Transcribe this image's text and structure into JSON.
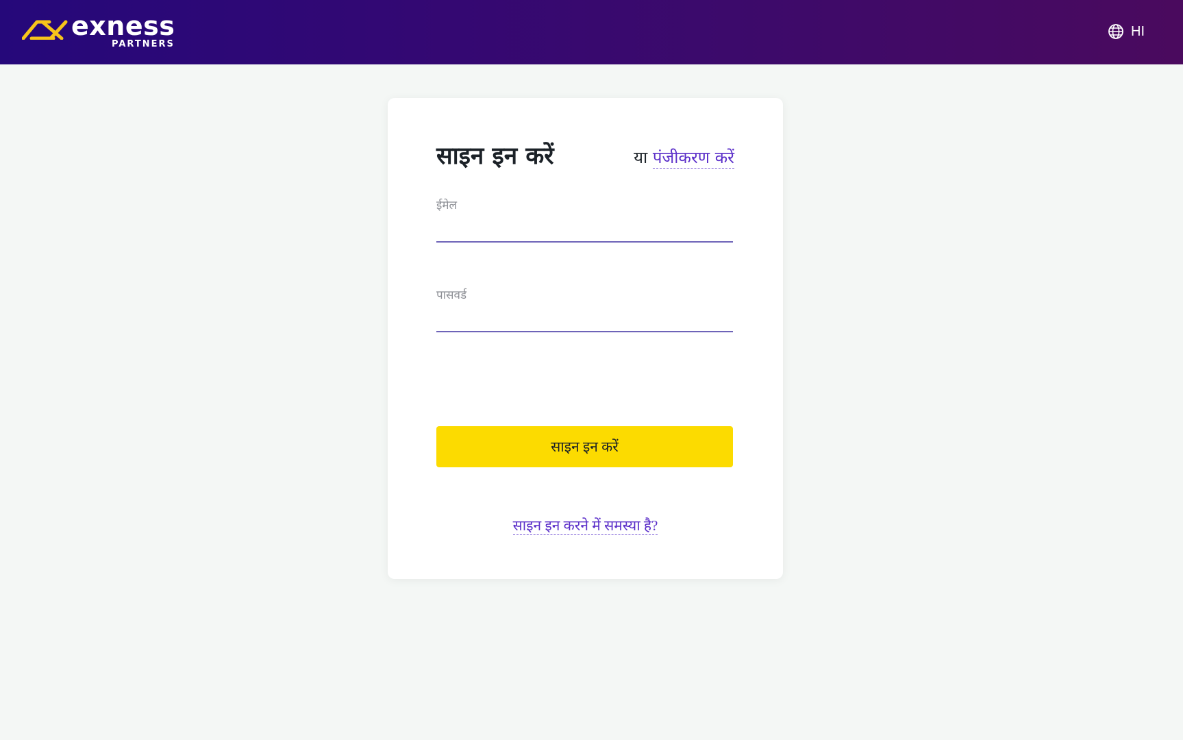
{
  "header": {
    "logo": {
      "word": "exness",
      "sub": "PARTNERS"
    },
    "language": {
      "icon": "globe-icon",
      "code": "HI"
    }
  },
  "form": {
    "title": "साइन इन करें",
    "register_prefix": "या",
    "register_link": "पंजीकरण करें",
    "email": {
      "label": "ईमेल",
      "value": ""
    },
    "password": {
      "label": "पासवर्ड",
      "value": ""
    },
    "submit_label": "साइन इन करें",
    "trouble_link": "साइन इन करने में समस्या है?"
  },
  "colors": {
    "header_gradient_start": "#25087a",
    "header_gradient_end": "#4a0a5e",
    "accent_yellow": "#fcdb00",
    "link_purple": "#5b2fc9",
    "background": "#f4f7f5"
  }
}
